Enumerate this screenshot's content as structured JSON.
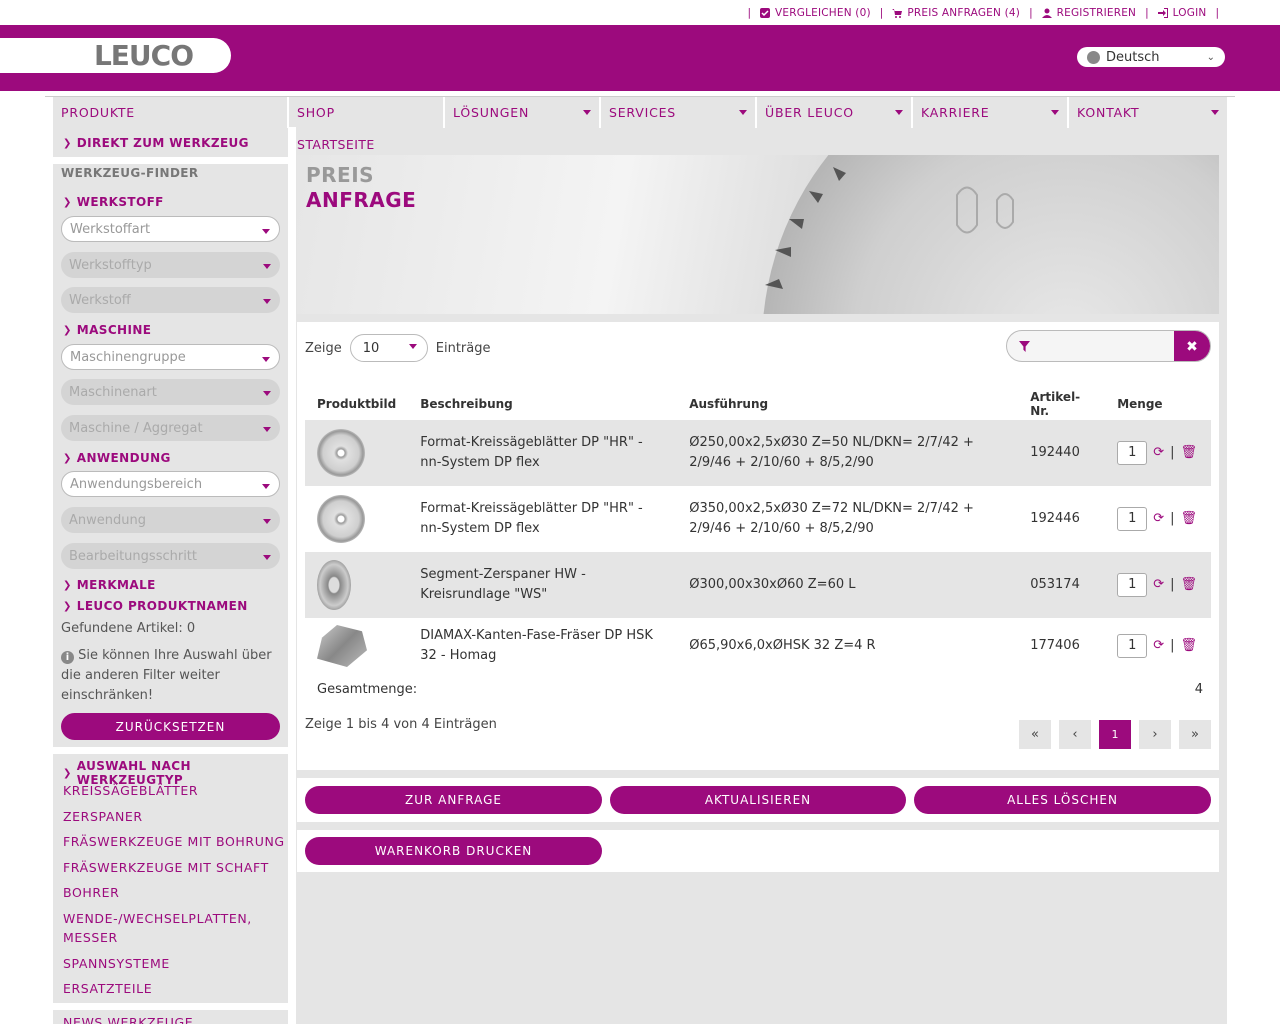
{
  "topbar": {
    "compare": "VERGLEICHEN (0)",
    "quote": "PREIS ANFRAGEN (4)",
    "register": "REGISTRIEREN",
    "login": "LOGIN"
  },
  "header": {
    "logo": "LEUCO",
    "language": "Deutsch"
  },
  "nav": [
    "PRODUKTE",
    "SHOP",
    "LÖSUNGEN",
    "SERVICES",
    "ÜBER LEUCO",
    "KARRIERE",
    "KONTAKT"
  ],
  "sidebar": {
    "direct": "DIREKT ZUM WERKZEUG",
    "finder": "WERKZEUG-FINDER",
    "werkstoff": "WERKSTOFF",
    "werkstoffart": "Werkstoffart",
    "werkstofftyp": "Werkstofftyp",
    "werkstoff_sel": "Werkstoff",
    "maschine": "MASCHINE",
    "maschinengruppe": "Maschinengruppe",
    "maschinenart": "Maschinenart",
    "aggregat": "Maschine / Aggregat",
    "anwendung": "ANWENDUNG",
    "anwendungsbereich": "Anwendungsbereich",
    "anwendung_sel": "Anwendung",
    "bearbeitungsschritt": "Bearbeitungsschritt",
    "merkmale": "MERKMALE",
    "produktnamen": "LEUCO PRODUKTNAMEN",
    "found": "Gefundene Artikel: 0",
    "hint": "Sie können Ihre Auswahl über die anderen Filter weiter einschränken!",
    "reset": "ZURÜCKSETZEN",
    "bytype": "AUSWAHL NACH WERKZEUGTYP",
    "types": [
      "KREISSÄGEBLÄTTER",
      "ZERSPANER",
      "FRÄSWERKZEUGE MIT BOHRUNG",
      "FRÄSWERKZEUGE MIT SCHAFT",
      "BOHRER",
      "WENDE-/WECHSELPLATTEN,",
      "MESSER",
      "SPANNSYSTEME",
      "ERSATZTEILE"
    ],
    "news": "NEWS WERKZEUGE"
  },
  "breadcrumb": "STARTSEITE",
  "banner": {
    "line1": "PREIS",
    "line2": "ANFRAGE"
  },
  "table": {
    "show": "Zeige",
    "length": "10",
    "entries": "Einträge",
    "headers": [
      "Produktbild",
      "Beschreibung",
      "Ausführung",
      "Artikel-Nr.",
      "Menge"
    ],
    "rows": [
      {
        "desc": "Format-Kreissägeblätter DP \"HR\" - nn-System DP flex",
        "spec": "Ø250,00x2,5xØ30 Z=50 NL/DKN= 2/7/42 + 2/9/46 + 2/10/60 + 8/5,2/90",
        "art": "192440",
        "qty": "1"
      },
      {
        "desc": "Format-Kreissägeblätter DP \"HR\" - nn-System DP flex",
        "spec": "Ø350,00x2,5xØ30 Z=72 NL/DKN= 2/7/42 + 2/9/46 + 2/10/60 + 8/5,2/90",
        "art": "192446",
        "qty": "1"
      },
      {
        "desc": "Segment-Zerspaner HW - Kreisrundlage \"WS\"",
        "spec": "Ø300,00x30xØ60 Z=60 L",
        "art": "053174",
        "qty": "1"
      },
      {
        "desc": "DIAMAX-Kanten-Fase-Fräser DP HSK 32 - Homag",
        "spec": "Ø65,90x6,0xØHSK 32 Z=4 R",
        "art": "177406",
        "qty": "1"
      }
    ],
    "total_label": "Gesamtmenge:",
    "total": "4",
    "info": "Zeige 1 bis 4 von 4 Einträgen",
    "page": "1"
  },
  "actions": {
    "to_request": "ZUR ANFRAGE",
    "update": "AKTUALISIEREN",
    "clear": "ALLES LÖSCHEN",
    "print": "WARENKORB DRUCKEN"
  },
  "colors": {
    "brand": "#9c0a7d",
    "panel": "#e5e5e5"
  }
}
